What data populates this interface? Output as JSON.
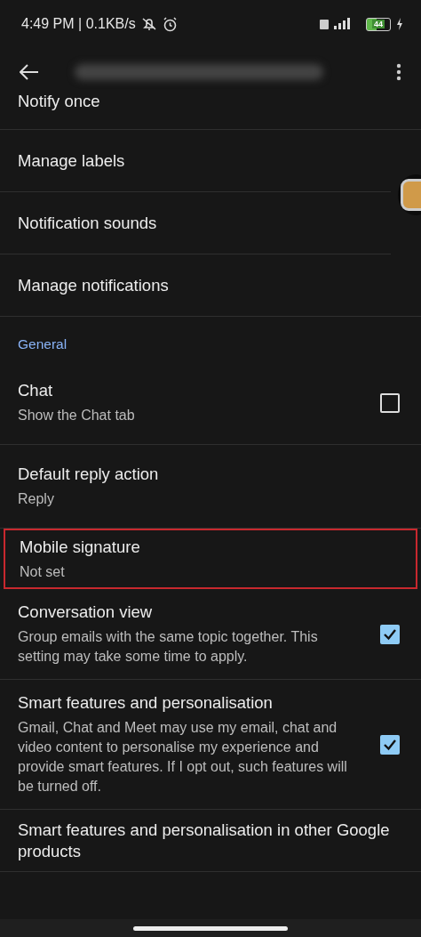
{
  "status_bar": {
    "time": "4:49 PM | 0.1KB/s",
    "battery": "44"
  },
  "settings": [
    {
      "kind": "plain",
      "title": "Notify once"
    },
    {
      "kind": "plain",
      "title": "Manage labels"
    },
    {
      "kind": "plain",
      "title": "Notification sounds"
    },
    {
      "kind": "plain",
      "title": "Manage notifications"
    },
    {
      "kind": "header",
      "title": "General"
    },
    {
      "kind": "checkbox",
      "title": "Chat",
      "subtitle": "Show the Chat tab",
      "checked": false
    },
    {
      "kind": "plain",
      "title": "Default reply action",
      "subtitle": "Reply"
    },
    {
      "kind": "plain",
      "title": "Mobile signature",
      "subtitle": "Not set",
      "highlighted": true
    },
    {
      "kind": "checkbox",
      "title": "Conversation view",
      "subtitle": "Group emails with the same topic together. This setting may take some time to apply.",
      "checked": true
    },
    {
      "kind": "checkbox",
      "title": "Smart features and personalisation",
      "subtitle": "Gmail, Chat and Meet may use my email, chat and video content to personalise my experience and provide smart features. If I opt out, such features will be turned off.",
      "checked": true
    },
    {
      "kind": "plain",
      "title": "Smart features and personalisation in other Google products"
    }
  ]
}
